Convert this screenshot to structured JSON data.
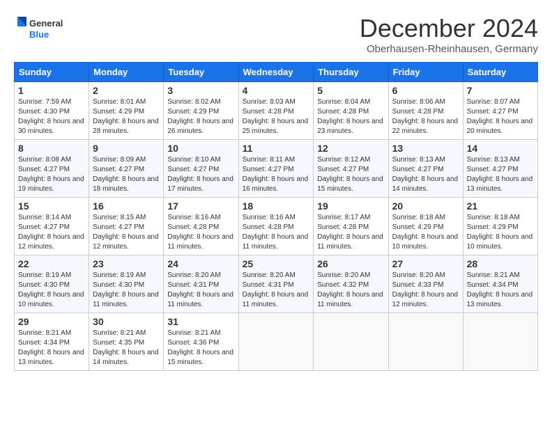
{
  "logo": {
    "line1": "General",
    "line2": "Blue"
  },
  "title": "December 2024",
  "location": "Oberhausen-Rheinhausen, Germany",
  "weekdays": [
    "Sunday",
    "Monday",
    "Tuesday",
    "Wednesday",
    "Thursday",
    "Friday",
    "Saturday"
  ],
  "weeks": [
    [
      {
        "day": "1",
        "sunrise": "7:59 AM",
        "sunset": "4:30 PM",
        "daylight": "8 hours and 30 minutes."
      },
      {
        "day": "2",
        "sunrise": "8:01 AM",
        "sunset": "4:29 PM",
        "daylight": "8 hours and 28 minutes."
      },
      {
        "day": "3",
        "sunrise": "8:02 AM",
        "sunset": "4:29 PM",
        "daylight": "8 hours and 26 minutes."
      },
      {
        "day": "4",
        "sunrise": "8:03 AM",
        "sunset": "4:28 PM",
        "daylight": "8 hours and 25 minutes."
      },
      {
        "day": "5",
        "sunrise": "8:04 AM",
        "sunset": "4:28 PM",
        "daylight": "8 hours and 23 minutes."
      },
      {
        "day": "6",
        "sunrise": "8:06 AM",
        "sunset": "4:28 PM",
        "daylight": "8 hours and 22 minutes."
      },
      {
        "day": "7",
        "sunrise": "8:07 AM",
        "sunset": "4:27 PM",
        "daylight": "8 hours and 20 minutes."
      }
    ],
    [
      {
        "day": "8",
        "sunrise": "8:08 AM",
        "sunset": "4:27 PM",
        "daylight": "8 hours and 19 minutes."
      },
      {
        "day": "9",
        "sunrise": "8:09 AM",
        "sunset": "4:27 PM",
        "daylight": "8 hours and 18 minutes."
      },
      {
        "day": "10",
        "sunrise": "8:10 AM",
        "sunset": "4:27 PM",
        "daylight": "8 hours and 17 minutes."
      },
      {
        "day": "11",
        "sunrise": "8:11 AM",
        "sunset": "4:27 PM",
        "daylight": "8 hours and 16 minutes."
      },
      {
        "day": "12",
        "sunrise": "8:12 AM",
        "sunset": "4:27 PM",
        "daylight": "8 hours and 15 minutes."
      },
      {
        "day": "13",
        "sunrise": "8:13 AM",
        "sunset": "4:27 PM",
        "daylight": "8 hours and 14 minutes."
      },
      {
        "day": "14",
        "sunrise": "8:13 AM",
        "sunset": "4:27 PM",
        "daylight": "8 hours and 13 minutes."
      }
    ],
    [
      {
        "day": "15",
        "sunrise": "8:14 AM",
        "sunset": "4:27 PM",
        "daylight": "8 hours and 12 minutes."
      },
      {
        "day": "16",
        "sunrise": "8:15 AM",
        "sunset": "4:27 PM",
        "daylight": "8 hours and 12 minutes."
      },
      {
        "day": "17",
        "sunrise": "8:16 AM",
        "sunset": "4:28 PM",
        "daylight": "8 hours and 11 minutes."
      },
      {
        "day": "18",
        "sunrise": "8:16 AM",
        "sunset": "4:28 PM",
        "daylight": "8 hours and 11 minutes."
      },
      {
        "day": "19",
        "sunrise": "8:17 AM",
        "sunset": "4:28 PM",
        "daylight": "8 hours and 11 minutes."
      },
      {
        "day": "20",
        "sunrise": "8:18 AM",
        "sunset": "4:29 PM",
        "daylight": "8 hours and 10 minutes."
      },
      {
        "day": "21",
        "sunrise": "8:18 AM",
        "sunset": "4:29 PM",
        "daylight": "8 hours and 10 minutes."
      }
    ],
    [
      {
        "day": "22",
        "sunrise": "8:19 AM",
        "sunset": "4:30 PM",
        "daylight": "8 hours and 10 minutes."
      },
      {
        "day": "23",
        "sunrise": "8:19 AM",
        "sunset": "4:30 PM",
        "daylight": "8 hours and 11 minutes."
      },
      {
        "day": "24",
        "sunrise": "8:20 AM",
        "sunset": "4:31 PM",
        "daylight": "8 hours and 11 minutes."
      },
      {
        "day": "25",
        "sunrise": "8:20 AM",
        "sunset": "4:31 PM",
        "daylight": "8 hours and 11 minutes."
      },
      {
        "day": "26",
        "sunrise": "8:20 AM",
        "sunset": "4:32 PM",
        "daylight": "8 hours and 11 minutes."
      },
      {
        "day": "27",
        "sunrise": "8:20 AM",
        "sunset": "4:33 PM",
        "daylight": "8 hours and 12 minutes."
      },
      {
        "day": "28",
        "sunrise": "8:21 AM",
        "sunset": "4:34 PM",
        "daylight": "8 hours and 13 minutes."
      }
    ],
    [
      {
        "day": "29",
        "sunrise": "8:21 AM",
        "sunset": "4:34 PM",
        "daylight": "8 hours and 13 minutes."
      },
      {
        "day": "30",
        "sunrise": "8:21 AM",
        "sunset": "4:35 PM",
        "daylight": "8 hours and 14 minutes."
      },
      {
        "day": "31",
        "sunrise": "8:21 AM",
        "sunset": "4:36 PM",
        "daylight": "8 hours and 15 minutes."
      },
      null,
      null,
      null,
      null
    ]
  ],
  "labels": {
    "sunrise": "Sunrise:",
    "sunset": "Sunset:",
    "daylight": "Daylight:"
  }
}
